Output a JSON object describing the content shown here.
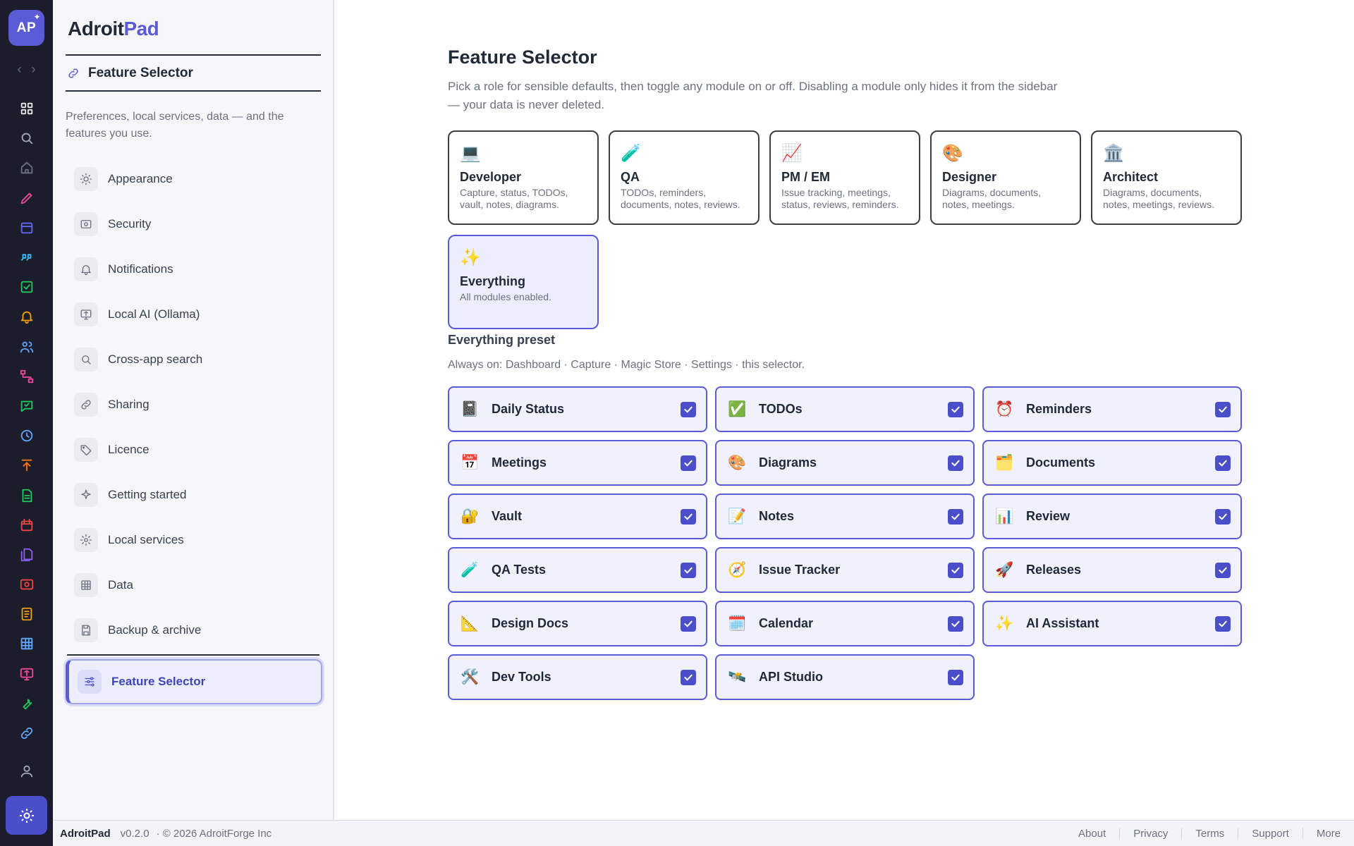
{
  "app": {
    "badge": "AP",
    "brand_main": "Adroit",
    "brand_accent": "Pad"
  },
  "rail": {
    "back": "‹",
    "forward": "›",
    "icons": [
      {
        "name": "dashboard-icon",
        "color": "#e5e7eb"
      },
      {
        "name": "search-icon",
        "color": "#a3a8b8"
      },
      {
        "name": "home-icon",
        "color": "#6b7080"
      },
      {
        "name": "capture-pen-icon",
        "color": "#ec4899"
      },
      {
        "name": "store-icon",
        "color": "#6366f1"
      },
      {
        "name": "quote-icon",
        "color": "#38bdf8"
      },
      {
        "name": "todo-check-icon",
        "color": "#22c55e"
      },
      {
        "name": "bell-icon",
        "color": "#f59e0b"
      },
      {
        "name": "users-icon",
        "color": "#60a5fa"
      },
      {
        "name": "diagram-icon",
        "color": "#ec4899"
      },
      {
        "name": "review-chat-icon",
        "color": "#22c55e"
      },
      {
        "name": "clock-icon",
        "color": "#60a5fa"
      },
      {
        "name": "release-upload-icon",
        "color": "#f97316"
      },
      {
        "name": "document-icon",
        "color": "#22c55e"
      },
      {
        "name": "calendar-icon",
        "color": "#ef4444"
      },
      {
        "name": "files-icon",
        "color": "#8b5cf6"
      },
      {
        "name": "vault-icon",
        "color": "#ef4444"
      },
      {
        "name": "notebook-icon",
        "color": "#f59e0b"
      },
      {
        "name": "table-icon",
        "color": "#60a5fa"
      },
      {
        "name": "ai-monitor-icon",
        "color": "#ec4899"
      },
      {
        "name": "wrench-icon",
        "color": "#22c55e"
      },
      {
        "name": "link-icon",
        "color": "#60a5fa"
      }
    ]
  },
  "sidebar": {
    "crumb": "Feature Selector",
    "description": "Preferences, local services, data — and the features you use.",
    "items": [
      {
        "label": "Appearance",
        "icon": "sun-icon"
      },
      {
        "label": "Security",
        "icon": "lock-box-icon"
      },
      {
        "label": "Notifications",
        "icon": "bell-icon"
      },
      {
        "label": "Local AI (Ollama)",
        "icon": "ai-monitor-icon"
      },
      {
        "label": "Cross-app search",
        "icon": "search-icon"
      },
      {
        "label": "Sharing",
        "icon": "link-icon"
      },
      {
        "label": "Licence",
        "icon": "tag-icon"
      },
      {
        "label": "Getting started",
        "icon": "sparkle-icon"
      },
      {
        "label": "Local services",
        "icon": "gear-icon"
      },
      {
        "label": "Data",
        "icon": "table-icon"
      },
      {
        "label": "Backup & archive",
        "icon": "save-icon"
      }
    ],
    "active": {
      "label": "Feature Selector",
      "icon": "sliders-icon"
    }
  },
  "main": {
    "title": "Feature Selector",
    "description": "Pick a role for sensible defaults, then toggle any module on or off. Disabling a module only hides it from the sidebar — your data is never deleted.",
    "roles": [
      {
        "emoji": "💻",
        "name": "Developer",
        "desc": "Capture, status, TODOs, vault, notes, diagrams.",
        "active": false
      },
      {
        "emoji": "🧪",
        "name": "QA",
        "desc": "TODOs, reminders, documents, notes, reviews.",
        "active": false
      },
      {
        "emoji": "📈",
        "name": "PM / EM",
        "desc": "Issue tracking, meetings, status, reviews, reminders.",
        "active": false
      },
      {
        "emoji": "🎨",
        "name": "Designer",
        "desc": "Diagrams, documents, notes, meetings.",
        "active": false
      },
      {
        "emoji": "🏛️",
        "name": "Architect",
        "desc": "Diagrams, documents, notes, meetings, reviews.",
        "active": false
      },
      {
        "emoji": "✨",
        "name": "Everything",
        "desc": "All modules enabled.",
        "active": true
      }
    ],
    "preset_title": "Everything preset",
    "always_on": "Always on: Dashboard · Capture · Magic Store · Settings · this selector.",
    "modules": [
      {
        "emoji": "📓",
        "label": "Daily Status",
        "checked": true
      },
      {
        "emoji": "✅",
        "label": "TODOs",
        "checked": true
      },
      {
        "emoji": "⏰",
        "label": "Reminders",
        "checked": true
      },
      {
        "emoji": "📅",
        "label": "Meetings",
        "checked": true
      },
      {
        "emoji": "🎨",
        "label": "Diagrams",
        "checked": true
      },
      {
        "emoji": "🗂️",
        "label": "Documents",
        "checked": true
      },
      {
        "emoji": "🔐",
        "label": "Vault",
        "checked": true
      },
      {
        "emoji": "📝",
        "label": "Notes",
        "checked": true
      },
      {
        "emoji": "📊",
        "label": "Review",
        "checked": true
      },
      {
        "emoji": "🧪",
        "label": "QA Tests",
        "checked": true
      },
      {
        "emoji": "🧭",
        "label": "Issue Tracker",
        "checked": true
      },
      {
        "emoji": "🚀",
        "label": "Releases",
        "checked": true
      },
      {
        "emoji": "📐",
        "label": "Design Docs",
        "checked": true
      },
      {
        "emoji": "🗓️",
        "label": "Calendar",
        "checked": true
      },
      {
        "emoji": "✨",
        "label": "AI Assistant",
        "checked": true
      },
      {
        "emoji": "🛠️",
        "label": "Dev Tools",
        "checked": true
      },
      {
        "emoji": "🛰️",
        "label": "API Studio",
        "checked": true
      }
    ]
  },
  "footer": {
    "brand": "AdroitPad",
    "version": "v0.2.0",
    "copyright": "· © 2026 AdroitForge Inc",
    "links": [
      "About",
      "Privacy",
      "Terms",
      "Support",
      "More"
    ]
  }
}
